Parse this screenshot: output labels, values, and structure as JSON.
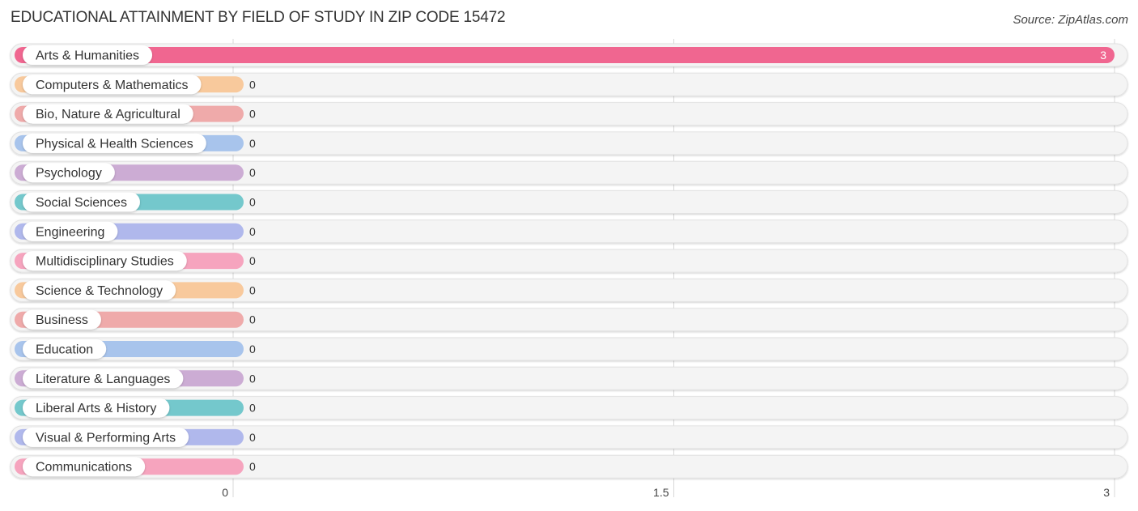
{
  "header": {
    "title": "EDUCATIONAL ATTAINMENT BY FIELD OF STUDY IN ZIP CODE 15472",
    "source": "Source: ZipAtlas.com"
  },
  "chart_data": {
    "type": "bar",
    "orientation": "horizontal",
    "title": "EDUCATIONAL ATTAINMENT BY FIELD OF STUDY IN ZIP CODE 15472",
    "xlabel": "",
    "ylabel": "",
    "xlim": [
      0,
      3
    ],
    "xticks": [
      "0",
      "1.5",
      "3"
    ],
    "xtick_values": [
      0,
      1.5,
      3
    ],
    "grid": true,
    "categories": [
      "Arts & Humanities",
      "Computers & Mathematics",
      "Bio, Nature & Agricultural",
      "Physical & Health Sciences",
      "Psychology",
      "Social Sciences",
      "Engineering",
      "Multidisciplinary Studies",
      "Science & Technology",
      "Business",
      "Education",
      "Literature & Languages",
      "Liberal Arts & History",
      "Visual & Performing Arts",
      "Communications"
    ],
    "values": [
      3,
      0,
      0,
      0,
      0,
      0,
      0,
      0,
      0,
      0,
      0,
      0,
      0,
      0,
      0
    ],
    "value_labels": [
      "3",
      "0",
      "0",
      "0",
      "0",
      "0",
      "0",
      "0",
      "0",
      "0",
      "0",
      "0",
      "0",
      "0",
      "0"
    ],
    "colors": [
      "#f06690",
      "#f8c99c",
      "#efaaaa",
      "#a8c4ec",
      "#ccacd4",
      "#74c8cc",
      "#b0b8ec",
      "#f6a4be",
      "#f8c99c",
      "#efaaaa",
      "#a8c4ec",
      "#ccacd4",
      "#74c8cc",
      "#b0b8ec",
      "#f6a4be"
    ]
  }
}
